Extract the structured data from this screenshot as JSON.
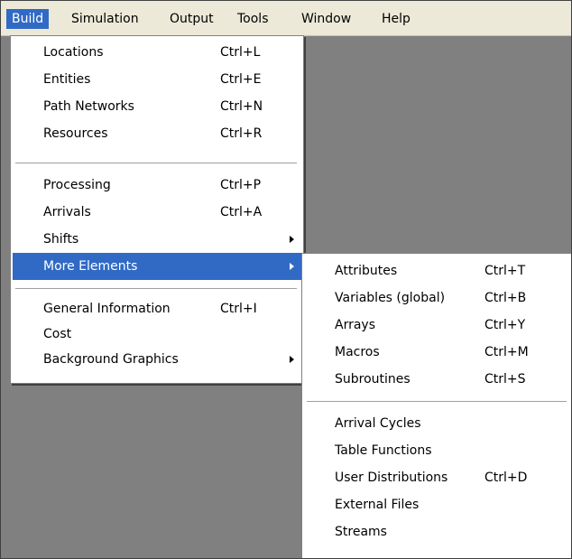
{
  "menubar": {
    "items": [
      {
        "label": "Build"
      },
      {
        "label": "Simulation"
      },
      {
        "label": "Output"
      },
      {
        "label": "Tools"
      },
      {
        "label": "Window"
      },
      {
        "label": "Help"
      }
    ],
    "active": "Build"
  },
  "build_menu": {
    "groups": [
      [
        {
          "label": "Locations",
          "shortcut": "Ctrl+L"
        },
        {
          "label": "Entities",
          "shortcut": "Ctrl+E"
        },
        {
          "label": "Path Networks",
          "shortcut": "Ctrl+N"
        },
        {
          "label": "Resources",
          "shortcut": "Ctrl+R"
        }
      ],
      [
        {
          "label": "Processing",
          "shortcut": "Ctrl+P"
        },
        {
          "label": "Arrivals",
          "shortcut": "Ctrl+A"
        },
        {
          "label": "Shifts",
          "shortcut": "",
          "has_submenu": true
        },
        {
          "label": "More Elements",
          "shortcut": "",
          "has_submenu": true,
          "highlighted": true
        }
      ],
      [
        {
          "label": "General Information",
          "shortcut": "Ctrl+I"
        },
        {
          "label": "Cost",
          "shortcut": ""
        },
        {
          "label": "Background Graphics",
          "shortcut": "",
          "has_submenu": true
        }
      ]
    ]
  },
  "more_elements_submenu": {
    "groups": [
      [
        {
          "label": "Attributes",
          "shortcut": "Ctrl+T"
        },
        {
          "label": "Variables (global)",
          "shortcut": "Ctrl+B"
        },
        {
          "label": "Arrays",
          "shortcut": "Ctrl+Y"
        },
        {
          "label": "Macros",
          "shortcut": "Ctrl+M"
        },
        {
          "label": "Subroutines",
          "shortcut": "Ctrl+S"
        }
      ],
      [
        {
          "label": "Arrival Cycles",
          "shortcut": ""
        },
        {
          "label": "Table Functions",
          "shortcut": ""
        },
        {
          "label": "User Distributions",
          "shortcut": "Ctrl+D"
        },
        {
          "label": "External Files",
          "shortcut": ""
        },
        {
          "label": "Streams",
          "shortcut": ""
        }
      ]
    ]
  },
  "colors": {
    "menubar_bg": "#ece9d8",
    "highlight": "#316ac5",
    "workspace": "#808080",
    "menu_bg": "#ffffff"
  }
}
